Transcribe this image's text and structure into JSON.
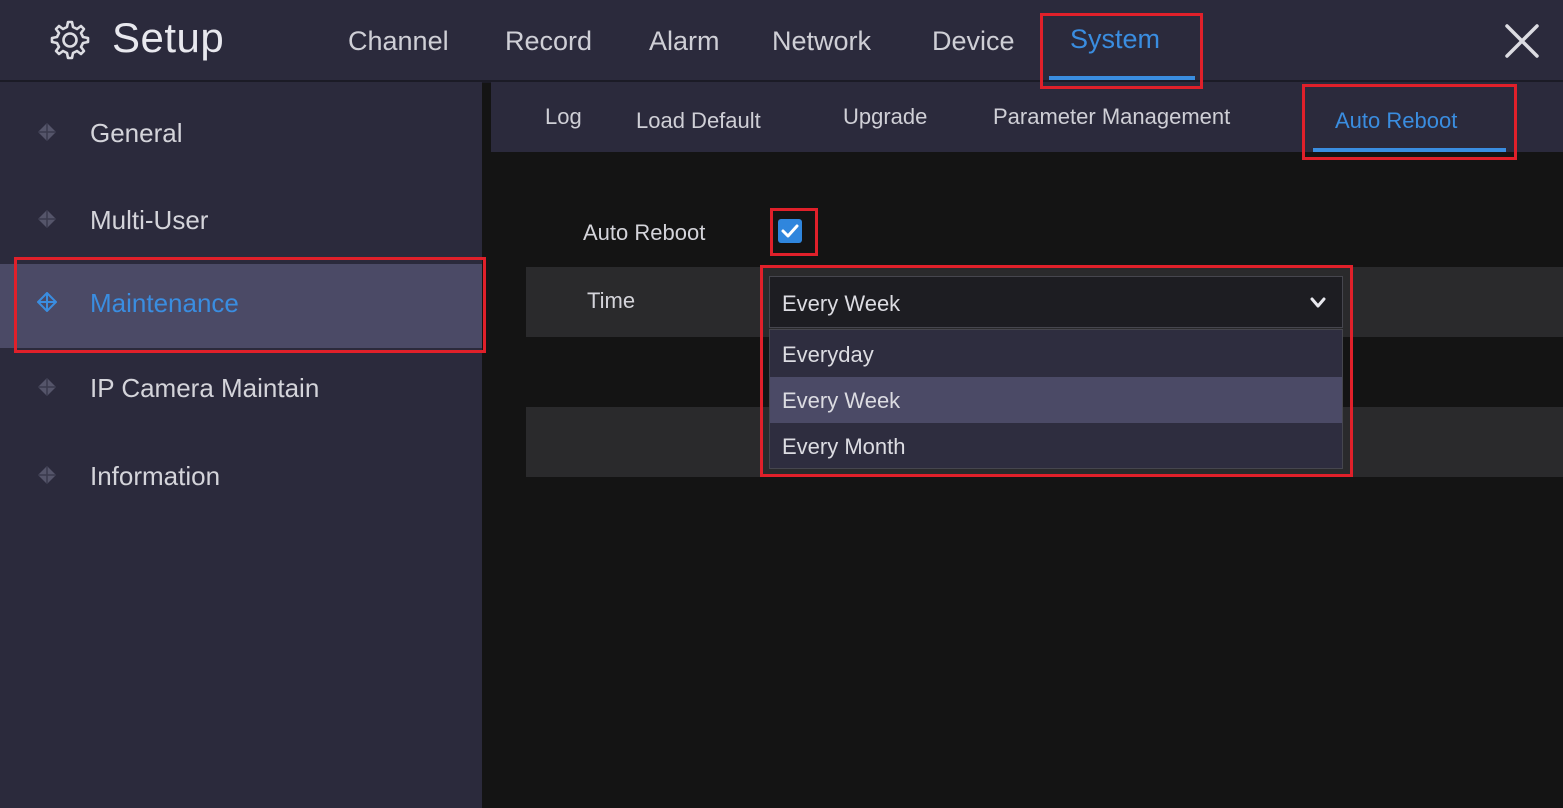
{
  "header": {
    "title": "Setup",
    "icon": "gear-icon",
    "tabs": [
      {
        "label": "Channel",
        "active": false
      },
      {
        "label": "Record",
        "active": false
      },
      {
        "label": "Alarm",
        "active": false
      },
      {
        "label": "Network",
        "active": false
      },
      {
        "label": "Device",
        "active": false
      },
      {
        "label": "System",
        "active": true
      }
    ],
    "close_icon": "close-icon"
  },
  "sidebar": {
    "items": [
      {
        "label": "General",
        "active": false
      },
      {
        "label": "Multi-User",
        "active": false
      },
      {
        "label": "Maintenance",
        "active": true
      },
      {
        "label": "IP Camera Maintain",
        "active": false
      },
      {
        "label": "Information",
        "active": false
      }
    ]
  },
  "subtabs": [
    {
      "label": "Log",
      "active": false
    },
    {
      "label": "Load Default",
      "active": false
    },
    {
      "label": "Upgrade",
      "active": false
    },
    {
      "label": "Parameter Management",
      "active": false
    },
    {
      "label": "Auto Reboot",
      "active": true
    }
  ],
  "settings": {
    "auto_reboot_label": "Auto Reboot",
    "auto_reboot_checked": true,
    "time_label": "Time",
    "time_value": "Every Week",
    "time_options": [
      "Everyday",
      "Every Week",
      "Every Month"
    ],
    "highlighted_option": "Every Week"
  },
  "colors": {
    "accent": "#3a8de0",
    "highlight_box": "#e0202a",
    "panel": "#2b2a3c",
    "selected_row": "#4b4a66",
    "background": "#141414"
  }
}
